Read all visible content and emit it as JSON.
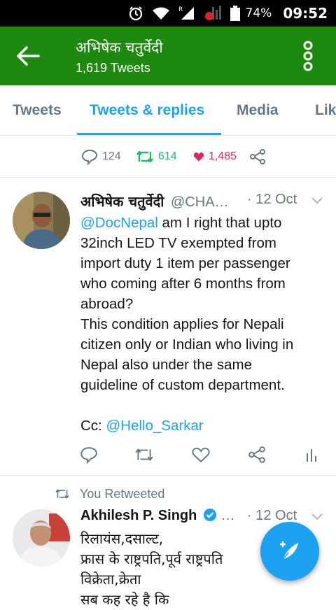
{
  "status_bar": {
    "battery": "74%",
    "time": "09:52",
    "icons": [
      "alarm-icon",
      "wifi-icon",
      "signal-icon",
      "battery-icon"
    ]
  },
  "app_bar": {
    "title": "अभिषेक चतुर्वेदी",
    "subtitle": "1,619 Tweets",
    "color": "#1d8a0f"
  },
  "tabs": [
    {
      "label": "Tweets",
      "active": false
    },
    {
      "label": "Tweets & replies",
      "active": true
    },
    {
      "label": "Media",
      "active": false
    },
    {
      "label": "Likes",
      "active": false
    }
  ],
  "previous_tweet_actions": {
    "replies": "124",
    "retweets": "614",
    "likes": "1,485"
  },
  "tweet": {
    "name": "अभिषेक चतुर्वेदी",
    "handle": "@CHA…",
    "date": "· 12 Oct",
    "mention": "@DocNepal",
    "body": " am I right that upto\n32inch LED TV exempted from\nimport duty 1 item per passenger\nwho coming after 6 months from\nabroad?\nThis condition applies for Nepali\ncitizen only or Indian who living in\nNepal also under the same\nguideline of custom department.\n\nCc: ",
    "cc_mention": "@Hello_Sarkar"
  },
  "retweet_context": {
    "label": "You Retweeted"
  },
  "tweet2": {
    "name": "Akhilesh P. Singh",
    "ellipsis": "…",
    "date": "· 12 Oct",
    "body": "रिलायंस,दसाल्ट,\nफ्रास के राष्ट्रपति,पूर्व राष्ट्रपति\nविक्रेता,क्रेता\nसब कह रहे है कि"
  },
  "colors": {
    "accent": "#1da1f2",
    "retweet_green": "#17bf63",
    "like_red": "#e0245e",
    "secondary_text": "#657786"
  }
}
